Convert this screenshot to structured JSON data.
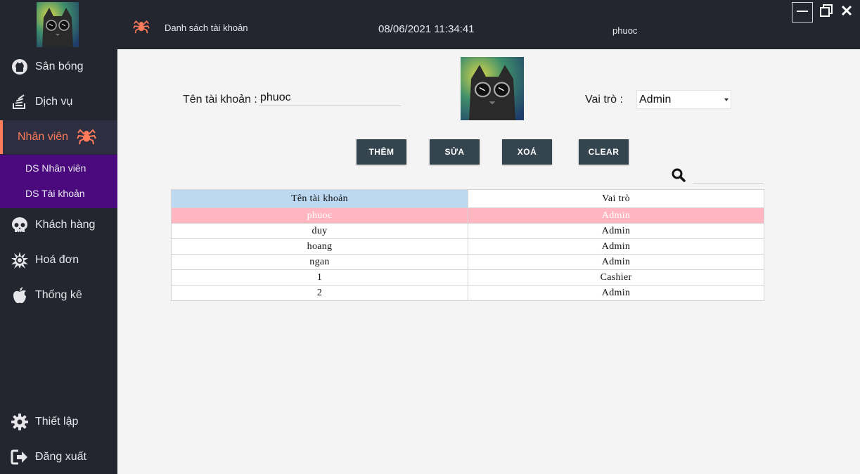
{
  "app": {
    "header_title": "Danh sách tài khoản",
    "datetime": "08/06/2021 11:34:41",
    "current_user": "phuoc"
  },
  "sidebar": {
    "items": [
      {
        "label": "Sân bóng",
        "icon": "github-icon"
      },
      {
        "label": "Dịch vụ",
        "icon": "stack-icon"
      },
      {
        "label": "Nhân viên",
        "icon": "spider-icon"
      },
      {
        "label": "Khách hàng",
        "icon": "skull-icon"
      },
      {
        "label": "Hoá đơn",
        "icon": "burst-icon"
      },
      {
        "label": "Thống kê",
        "icon": "apple-icon"
      }
    ],
    "submenu": [
      "DS Nhân viên",
      "DS Tài khoản"
    ],
    "bottom": [
      {
        "label": "Thiết lập",
        "icon": "gear-icon"
      },
      {
        "label": "Đăng xuất",
        "icon": "logout-icon"
      }
    ]
  },
  "form": {
    "username_label": "Tên tài khoản :",
    "username_value": "phuoc",
    "role_label": "Vai trò :",
    "role_value": "Admin"
  },
  "buttons": {
    "add": "THÊM",
    "edit": "SỬA",
    "delete": "XOÁ",
    "clear": "CLEAR"
  },
  "table": {
    "columns": [
      "Tên tài khoản",
      "Vai trò"
    ],
    "rows": [
      [
        "phuoc",
        "Admin"
      ],
      [
        "duy",
        "Admin"
      ],
      [
        "hoang",
        "Admin"
      ],
      [
        "ngan",
        "Admin"
      ],
      [
        "1",
        "Cashier"
      ],
      [
        "2",
        "Admin"
      ]
    ]
  },
  "colors": {
    "sidebar_bg": "#23252f",
    "accent": "#ff7b5a",
    "submenu_bg": "#4a0a7e",
    "button_bg": "#34454f",
    "selected_row": "#ffb6c1",
    "header_sorted": "#bcd9f1"
  }
}
